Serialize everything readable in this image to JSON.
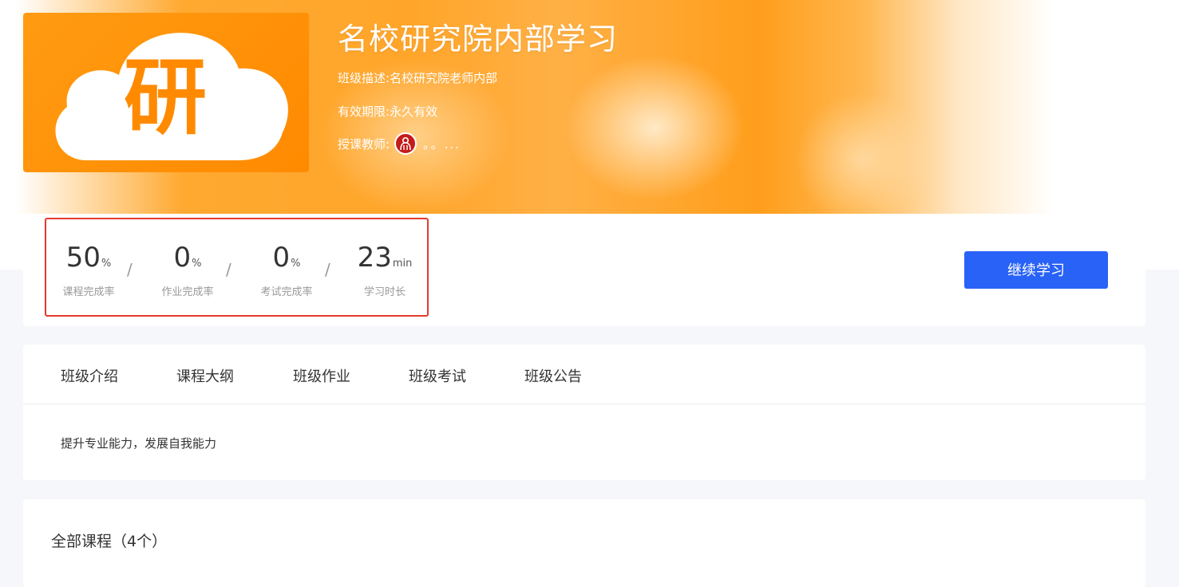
{
  "class": {
    "cover_char": "研",
    "title": "名校研究院内部学习",
    "description_label": "班级描述:",
    "description": "名校研究院老师内部",
    "validity_label": "有效期限:",
    "validity": "永久有效",
    "teacher_label": "授课教师:",
    "teacher_more": "。。..."
  },
  "stats": [
    {
      "value": "50",
      "unit": "%",
      "label": "课程完成率"
    },
    {
      "value": "0",
      "unit": "%",
      "label": "作业完成率"
    },
    {
      "value": "0",
      "unit": "%",
      "label": "考试完成率"
    },
    {
      "value": "23",
      "unit": "min",
      "label": "学习时长"
    }
  ],
  "separator": "/",
  "continue_button": "继续学习",
  "tabs": [
    "班级介绍",
    "课程大纲",
    "班级作业",
    "班级考试",
    "班级公告"
  ],
  "intro_text": "提升专业能力，发展自我能力",
  "courses_title": "全部课程（4个）",
  "colors": {
    "accent": "#2962f6",
    "brand_orange": "#ff8a00",
    "highlight_border": "#e43a2e"
  }
}
